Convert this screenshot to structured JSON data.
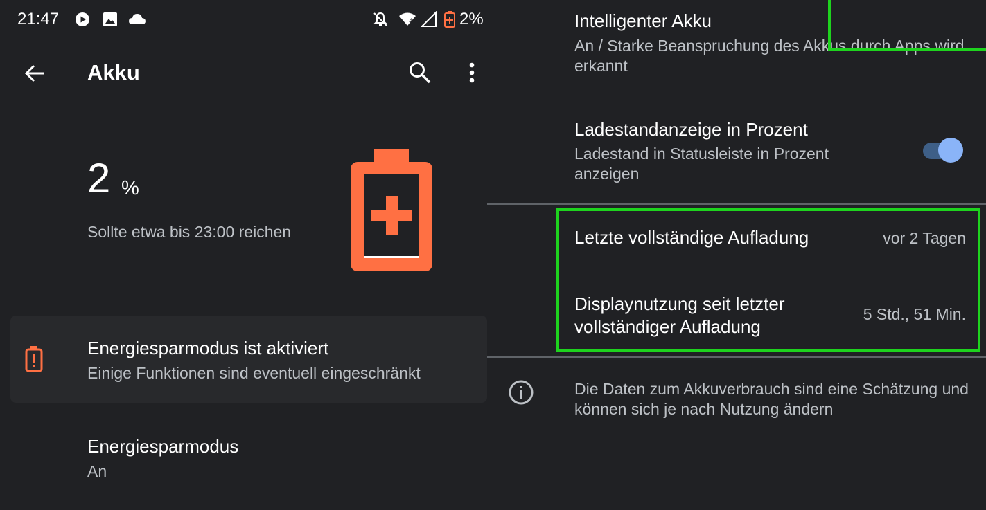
{
  "status_bar": {
    "time": "21:47",
    "battery_percent": "2%",
    "icons": [
      "media-play-icon",
      "image-icon",
      "cloud-icon",
      "notifications-off-icon",
      "wifi-icon",
      "signal-icon",
      "battery-charging-icon"
    ]
  },
  "app_bar": {
    "title": "Akku",
    "back_icon": "arrow-back-icon",
    "search_icon": "search-icon",
    "more_icon": "more-vert-icon"
  },
  "battery": {
    "level": "2",
    "unit": "%",
    "estimate": "Sollte etwa bis 23:00 reichen",
    "icon_color": "#ff7043"
  },
  "saver_banner": {
    "title": "Energiesparmodus ist aktiviert",
    "subtitle": "Einige Funktionen sind eventuell eingeschränkt",
    "icon": "battery-alert-icon",
    "icon_color": "#ff7043"
  },
  "saver_mode": {
    "title": "Energiesparmodus",
    "state": "An"
  },
  "smart_battery": {
    "title": "Intelligenter Akku",
    "subtitle": "An / Starke Beanspruchung des Akkus durch Apps wird erkannt"
  },
  "percentage_setting": {
    "title": "Ladestandanzeige in Prozent",
    "subtitle": "Ladestand in Statusleiste in Prozent anzeigen",
    "toggle_on": true
  },
  "last_full_charge": {
    "label": "Letzte vollständige Aufladung",
    "value": "vor 2 Tagen"
  },
  "screen_usage": {
    "label": "Displaynutzung seit letzter vollständiger Aufladung",
    "value": "5 Std., 51 Min."
  },
  "info": {
    "icon": "info-icon",
    "text": "Die Daten zum Akkuverbrauch sind eine Schätzung und können sich je nach Nutzung ändern"
  },
  "colors": {
    "background": "#202124",
    "highlight": "#1ed31e",
    "accent": "#8ab4f8"
  }
}
